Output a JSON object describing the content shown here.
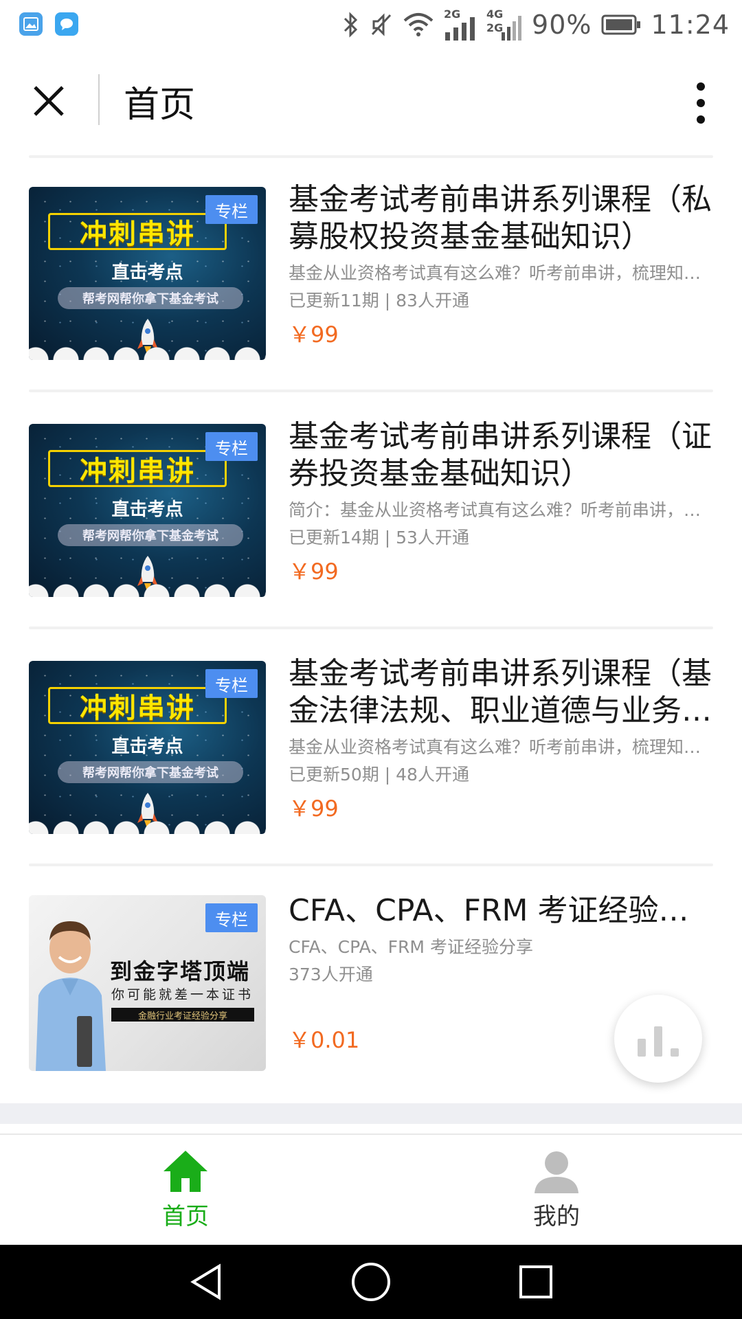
{
  "status_bar": {
    "battery": "90%",
    "time": "11:24",
    "net_2g": "2G",
    "net_4g": "4G",
    "net_4g_2g": "2G"
  },
  "header": {
    "title": "首页"
  },
  "thumb_text": {
    "sprint": "冲刺串讲",
    "subtitle": "直击考点",
    "slogan": "帮考网帮你拿下基金考试",
    "tag": "专栏",
    "pyramid_title": "到金字塔顶端",
    "pyramid_sub": "你可能就差一本证书",
    "pyramid_bar": "金融行业考证经验分享"
  },
  "courses": [
    {
      "title": "基金考试考前串讲系列课程（私募股权投资基金基础知识）",
      "description": "基金从业资格考试真有这么难？听考前串讲，梳理知识点",
      "meta": "已更新11期 | 83人开通",
      "price": "￥99"
    },
    {
      "title": "基金考试考前串讲系列课程（证券投资基金基础知识）",
      "description": "简介：基金从业资格考试真有这么难？听考前串讲，梳理知识点",
      "meta": "已更新14期 | 53人开通",
      "price": "￥99"
    },
    {
      "title": "基金考试考前串讲系列课程（基金法律法规、职业道德与业务规范）",
      "description": "基金从业资格考试真有这么难？听考前串讲，梳理知识点",
      "meta": "已更新50期 | 48人开通",
      "price": "￥99"
    },
    {
      "title": "CFA、CPA、FRM 考证经验分享",
      "description": "CFA、CPA、FRM 考证经验分享",
      "meta": "373人开通",
      "price": "￥0.01"
    }
  ],
  "tabs": [
    {
      "label": "首页",
      "icon": "home-icon",
      "active": true
    },
    {
      "label": "我的",
      "icon": "user-icon",
      "active": false
    }
  ],
  "colors": {
    "accent_green": "#1aad19",
    "price_orange": "#f26a21",
    "tag_blue": "#4d8ef0"
  }
}
